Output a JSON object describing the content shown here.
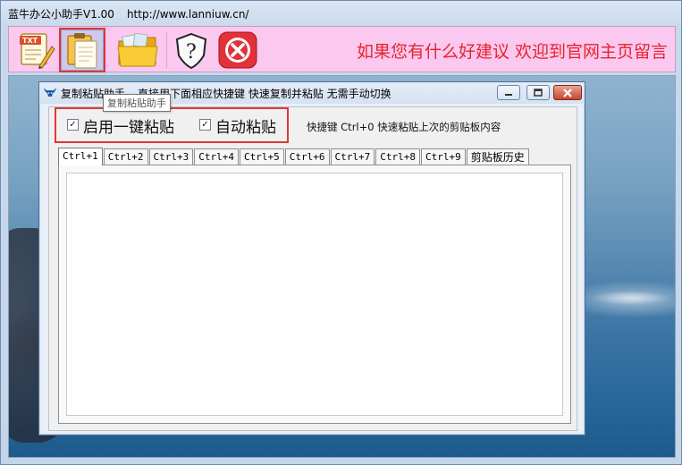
{
  "outer_window": {
    "title": "蓝牛办公小助手V1.00",
    "url": "http://www.lanniuw.cn/"
  },
  "toolbar": {
    "buttons": [
      {
        "name": "txt-edit-icon",
        "highlighted": false
      },
      {
        "name": "clipboard-icon",
        "highlighted": true
      },
      {
        "name": "folder-icon",
        "highlighted": false
      },
      {
        "name": "help-shield-icon",
        "highlighted": false
      },
      {
        "name": "close-icon",
        "highlighted": false
      }
    ],
    "banner_text": "如果您有什么好建议 欢迎到官网主页留言",
    "banner_color": "#e8232c",
    "background_color": "#fbc8f0"
  },
  "tooltip": {
    "text": "复制粘贴助手"
  },
  "dialog": {
    "title": "复制粘贴助手",
    "description": "直接用下面相应快捷键 快速复制并粘贴 无需手动切换",
    "options": {
      "enable_one_key_paste": {
        "label": "启用一键粘贴",
        "checked": true
      },
      "auto_paste": {
        "label": "自动粘贴",
        "checked": true
      }
    },
    "hint": "快捷键 Ctrl+0 快速粘贴上次的剪贴板内容",
    "tabs": [
      {
        "label": "Ctrl+1",
        "active": true
      },
      {
        "label": "Ctrl+2",
        "active": false
      },
      {
        "label": "Ctrl+3",
        "active": false
      },
      {
        "label": "Ctrl+4",
        "active": false
      },
      {
        "label": "Ctrl+5",
        "active": false
      },
      {
        "label": "Ctrl+6",
        "active": false
      },
      {
        "label": "Ctrl+7",
        "active": false
      },
      {
        "label": "Ctrl+8",
        "active": false
      },
      {
        "label": "Ctrl+9",
        "active": false
      },
      {
        "label": "剪贴板历史",
        "active": false
      }
    ],
    "textarea_value": ""
  }
}
